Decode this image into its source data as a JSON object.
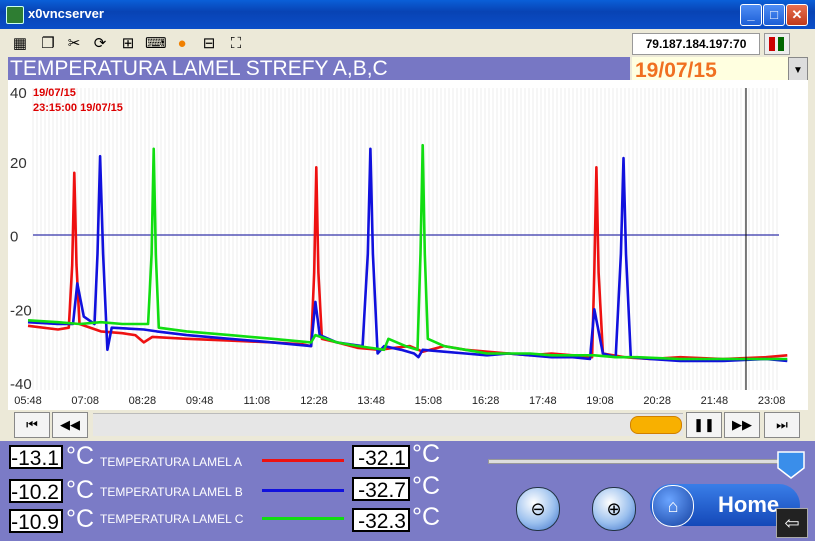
{
  "window": {
    "title": "x0vncserver"
  },
  "toolbar": {
    "ip_address": "79.187.184.197:70"
  },
  "header": {
    "title": "TEMPERATURA LAMEL STREFY A,B,C",
    "date": "19/07/15"
  },
  "chart_data": {
    "type": "line",
    "ylim": [
      -40,
      40
    ],
    "yticks": [
      "40",
      "20",
      "0",
      "-20",
      "-40"
    ],
    "xticks": [
      "05:48",
      "07:08",
      "08:28",
      "09:48",
      "11:08",
      "12:28",
      "13:48",
      "15:08",
      "16:28",
      "17:48",
      "19:08",
      "20:28",
      "21:48",
      "23:08"
    ],
    "cursor": {
      "date": "19/07/15",
      "label": "23:15:00  19/07/15"
    },
    "reference_line": 0,
    "series": [
      {
        "name": "TEMPERATURA LAMEL A",
        "color": "#ee1111",
        "points": [
          [
            5.8,
            -24.5
          ],
          [
            6.5,
            -25.5
          ],
          [
            6.75,
            -25
          ],
          [
            6.83,
            -8
          ],
          [
            6.88,
            17
          ],
          [
            6.93,
            -8
          ],
          [
            7.0,
            -24
          ],
          [
            7.5,
            -26
          ],
          [
            8.0,
            -26.5
          ],
          [
            8.3,
            -27
          ],
          [
            8.5,
            -29
          ],
          [
            8.7,
            -27.5
          ],
          [
            9.5,
            -28
          ],
          [
            10.5,
            -28.5
          ],
          [
            11.5,
            -29
          ],
          [
            12.2,
            -29.5
          ],
          [
            12.4,
            -30
          ],
          [
            12.47,
            -10
          ],
          [
            12.52,
            18.5
          ],
          [
            12.57,
            -10
          ],
          [
            12.65,
            -28
          ],
          [
            13.0,
            -29
          ],
          [
            13.5,
            -30.5
          ],
          [
            14.0,
            -31
          ],
          [
            14.3,
            -30.5
          ],
          [
            14.7,
            -30
          ],
          [
            15.0,
            -31.5
          ],
          [
            15.5,
            -30
          ],
          [
            16.0,
            -31
          ],
          [
            16.5,
            -31.5
          ],
          [
            17.0,
            -32
          ],
          [
            17.5,
            -32.5
          ],
          [
            18.0,
            -32
          ],
          [
            18.5,
            -32.5
          ],
          [
            18.95,
            -33
          ],
          [
            19.0,
            -10
          ],
          [
            19.05,
            18.5
          ],
          [
            19.1,
            -10
          ],
          [
            19.2,
            -32
          ],
          [
            19.7,
            -33
          ],
          [
            20.3,
            -33.5
          ],
          [
            21.0,
            -33
          ],
          [
            22.0,
            -33.5
          ],
          [
            23.0,
            -33
          ],
          [
            23.5,
            -32.5
          ]
        ]
      },
      {
        "name": "TEMPERATURA LAMEL B",
        "color": "#1111dd",
        "points": [
          [
            5.8,
            -23.5
          ],
          [
            6.5,
            -24
          ],
          [
            6.85,
            -24
          ],
          [
            6.95,
            -13
          ],
          [
            7.1,
            -22
          ],
          [
            7.35,
            -24
          ],
          [
            7.42,
            -5
          ],
          [
            7.48,
            21.5
          ],
          [
            7.55,
            -5
          ],
          [
            7.65,
            -31
          ],
          [
            7.75,
            -25
          ],
          [
            8.5,
            -25.5
          ],
          [
            8.8,
            -26
          ],
          [
            9.5,
            -27
          ],
          [
            10.5,
            -28
          ],
          [
            11.5,
            -29
          ],
          [
            12.4,
            -30
          ],
          [
            12.5,
            -18
          ],
          [
            12.6,
            -27
          ],
          [
            13.0,
            -29
          ],
          [
            13.6,
            -30
          ],
          [
            13.72,
            -5
          ],
          [
            13.78,
            23.5
          ],
          [
            13.84,
            -5
          ],
          [
            13.95,
            -32
          ],
          [
            14.1,
            -30
          ],
          [
            14.5,
            -31
          ],
          [
            14.8,
            -32
          ],
          [
            14.9,
            -33
          ],
          [
            15.0,
            -31
          ],
          [
            15.5,
            -31.5
          ],
          [
            16.0,
            -32
          ],
          [
            16.5,
            -32.5
          ],
          [
            17.0,
            -32
          ],
          [
            17.5,
            -32.5
          ],
          [
            18.0,
            -33
          ],
          [
            18.5,
            -33
          ],
          [
            18.9,
            -33.5
          ],
          [
            19.0,
            -20
          ],
          [
            19.2,
            -32
          ],
          [
            19.5,
            -33
          ],
          [
            19.62,
            -5
          ],
          [
            19.68,
            21
          ],
          [
            19.74,
            -5
          ],
          [
            19.85,
            -33
          ],
          [
            20.3,
            -33.5
          ],
          [
            21.0,
            -34
          ],
          [
            22.0,
            -34
          ],
          [
            23.0,
            -33.5
          ],
          [
            23.5,
            -34
          ]
        ]
      },
      {
        "name": "TEMPERATURA LAMEL C",
        "color": "#11dd11",
        "points": [
          [
            5.8,
            -23
          ],
          [
            6.5,
            -23.5
          ],
          [
            7.0,
            -24
          ],
          [
            7.5,
            -23.5
          ],
          [
            8.0,
            -24
          ],
          [
            8.6,
            -24
          ],
          [
            8.68,
            -5
          ],
          [
            8.73,
            23.5
          ],
          [
            8.78,
            -5
          ],
          [
            8.85,
            -25
          ],
          [
            9.5,
            -26
          ],
          [
            10.5,
            -27
          ],
          [
            11.5,
            -28
          ],
          [
            12.4,
            -29
          ],
          [
            12.5,
            -27
          ],
          [
            13.0,
            -29
          ],
          [
            13.5,
            -30
          ],
          [
            14.1,
            -31
          ],
          [
            14.2,
            -28
          ],
          [
            14.6,
            -30
          ],
          [
            14.88,
            -31
          ],
          [
            14.95,
            -5
          ],
          [
            15.0,
            24.5
          ],
          [
            15.05,
            -5
          ],
          [
            15.12,
            -28
          ],
          [
            15.5,
            -30
          ],
          [
            16.0,
            -31
          ],
          [
            16.5,
            -32
          ],
          [
            17.0,
            -32
          ],
          [
            17.5,
            -32
          ],
          [
            18.0,
            -32.5
          ],
          [
            18.5,
            -32.5
          ],
          [
            19.0,
            -32.5
          ],
          [
            19.5,
            -33
          ],
          [
            20.0,
            -33
          ],
          [
            21.0,
            -33.5
          ],
          [
            22.0,
            -33.5
          ],
          [
            23.0,
            -33.5
          ],
          [
            23.5,
            -33.5
          ]
        ]
      }
    ]
  },
  "legend": {
    "rows": [
      {
        "left_value": "-13.1",
        "unit": "°C",
        "name": "TEMPERATURA LAMEL A",
        "right_value": "-32.1",
        "color": "#ee1111"
      },
      {
        "left_value": "-10.2",
        "unit": "°C",
        "name": "TEMPERATURA LAMEL B",
        "right_value": "-32.7",
        "color": "#1111dd"
      },
      {
        "left_value": "-10.9",
        "unit": "°C",
        "name": "TEMPERATURA LAMEL C",
        "right_value": "-32.3",
        "color": "#11dd11"
      }
    ],
    "unit_right": "°C"
  },
  "controls": {
    "home_label": "Home"
  },
  "icons": [
    "app-icon",
    "minimize-icon",
    "maximize-icon",
    "close-icon",
    "first-icon",
    "rewind-icon",
    "pause-icon",
    "forward-icon",
    "last-icon",
    "zoom-out-icon",
    "zoom-in-icon",
    "home-icon",
    "back-icon"
  ]
}
